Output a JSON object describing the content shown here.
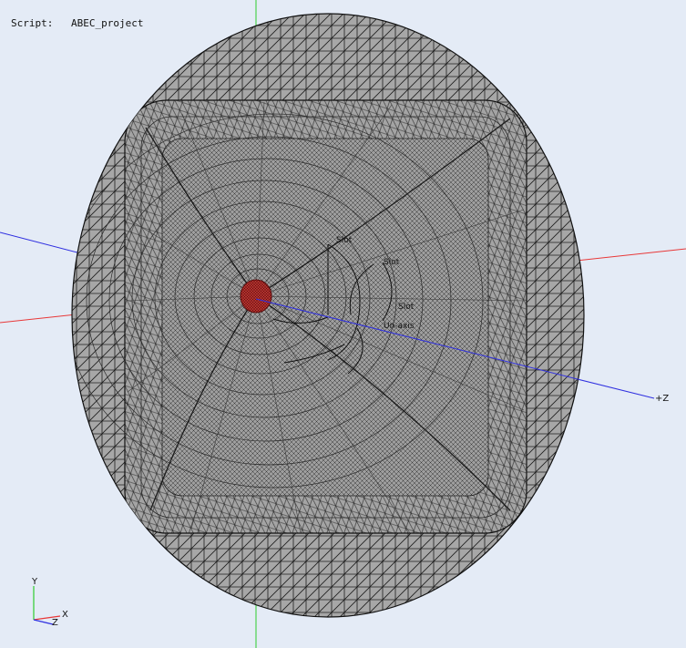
{
  "script_info": {
    "label": "Script:",
    "value": "ABEC_project"
  },
  "axes": {
    "z_axis_label": "+Z"
  },
  "annotations": {
    "slot_1": "Slot",
    "slot_2": "Slot",
    "slot_3": "Slot",
    "axis_note": "Un-axis"
  },
  "triad": {
    "y_label": "Y",
    "x_label": "X",
    "z_label": "Z"
  },
  "colors": {
    "background": "#e4ebf6",
    "mesh_fill": "#a7a7a7",
    "mesh_lines": "#1e1e1e",
    "x_axis": "#e83838",
    "y_axis": "#2ecc2e",
    "z_axis": "#2f2fe0",
    "driver": "#a11a1a"
  }
}
